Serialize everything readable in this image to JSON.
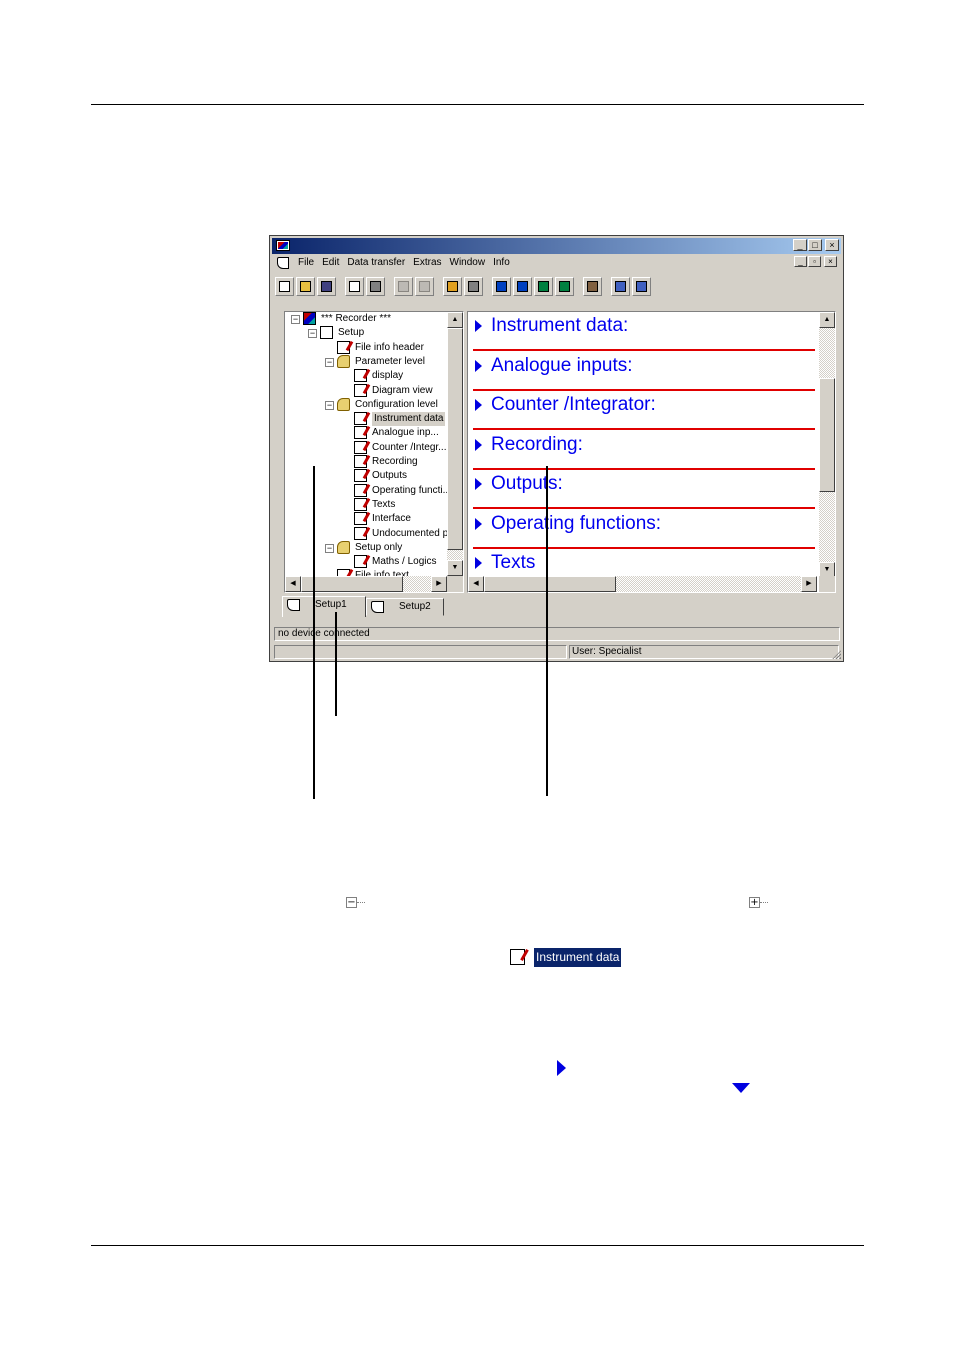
{
  "window": {
    "menus": [
      "File",
      "Edit",
      "Data transfer",
      "Extras",
      "Window",
      "Info"
    ],
    "caption_glyphs": {
      "minimize": "_",
      "maximize": "□",
      "close": "×",
      "restore": "▫"
    }
  },
  "toolbar": {
    "icons": [
      "new-file-icon",
      "open-folder-icon",
      "save-icon",
      "print-preview-icon",
      "print-icon",
      "undo-icon",
      "redo-icon",
      "data-transfer-icon",
      "connect-icon",
      "nav-left-icon",
      "nav-down-icon",
      "nav-up-icon",
      "nav-right-icon",
      "user-icon",
      "cascade-windows-icon",
      "tile-windows-icon"
    ]
  },
  "tree": {
    "nodes": [
      {
        "label": "*** Recorder ***",
        "level": 0,
        "icon": "recorder-icon",
        "expander": "−"
      },
      {
        "label": "Setup",
        "level": 1,
        "icon": "setup-icon",
        "expander": "−"
      },
      {
        "label": "File info header",
        "level": 2,
        "icon": "page-edit-icon",
        "expander": ""
      },
      {
        "label": "Parameter level",
        "level": 2,
        "icon": "folder-icon",
        "expander": "−"
      },
      {
        "label": "display",
        "level": 3,
        "icon": "page-edit-icon",
        "expander": ""
      },
      {
        "label": "Diagram view",
        "level": 3,
        "icon": "page-edit-icon",
        "expander": ""
      },
      {
        "label": "Configuration level",
        "level": 2,
        "icon": "folder-icon",
        "expander": "−"
      },
      {
        "label": "Instrument data",
        "level": 3,
        "icon": "page-edit-icon",
        "expander": "",
        "selected": true
      },
      {
        "label": "Analogue inp...",
        "level": 3,
        "icon": "page-edit-icon",
        "expander": ""
      },
      {
        "label": "Counter /Integr...",
        "level": 3,
        "icon": "page-edit-icon",
        "expander": ""
      },
      {
        "label": "Recording",
        "level": 3,
        "icon": "page-edit-icon",
        "expander": ""
      },
      {
        "label": "Outputs",
        "level": 3,
        "icon": "page-edit-icon",
        "expander": ""
      },
      {
        "label": "Operating functi...",
        "level": 3,
        "icon": "page-edit-icon",
        "expander": ""
      },
      {
        "label": "Texts",
        "level": 3,
        "icon": "page-edit-icon",
        "expander": ""
      },
      {
        "label": "Interface",
        "level": 3,
        "icon": "page-edit-icon",
        "expander": ""
      },
      {
        "label": "Undocumented p...",
        "level": 3,
        "icon": "page-edit-icon",
        "expander": ""
      },
      {
        "label": "Setup only",
        "level": 2,
        "icon": "folder-icon",
        "expander": "−"
      },
      {
        "label": "Maths / Logics",
        "level": 3,
        "icon": "page-edit-icon",
        "expander": ""
      },
      {
        "label": "File info text",
        "level": 2,
        "icon": "page-edit-icon",
        "expander": ""
      }
    ]
  },
  "sections": [
    "Instrument data:",
    "Analogue inputs:",
    "Counter /Integrator:",
    "Recording:",
    "Outputs:",
    "Operating functions:",
    "Texts"
  ],
  "tabs": [
    "Setup1",
    "Setup2"
  ],
  "status": {
    "connection": "no device connected",
    "user": "User: Specialist"
  },
  "symbols": {
    "collapse": "−",
    "expand": "+",
    "highlight_sample": "Instrument data"
  },
  "colors": {
    "section_text": "#0000ee",
    "section_rule": "#e00000",
    "selection": "#0a246a"
  }
}
